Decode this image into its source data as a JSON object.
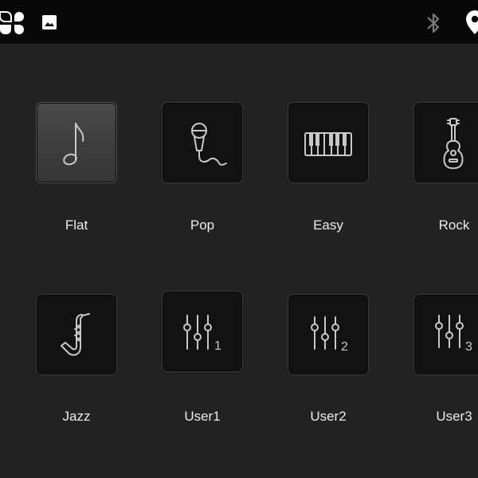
{
  "status_bar": {
    "icons": [
      "apps-grid-icon",
      "image-icon",
      "bluetooth-icon",
      "location-pin-icon"
    ]
  },
  "equalizer": {
    "presets": [
      {
        "label": "Flat",
        "icon": "music-note-icon",
        "selected": true
      },
      {
        "label": "Pop",
        "icon": "microphone-icon",
        "selected": false
      },
      {
        "label": "Easy",
        "icon": "piano-keys-icon",
        "selected": false
      },
      {
        "label": "Rock",
        "icon": "guitar-icon",
        "selected": false
      },
      {
        "label": "Jazz",
        "icon": "saxophone-icon",
        "selected": false
      },
      {
        "label": "User1",
        "icon": "sliders-1-icon",
        "selected": false
      },
      {
        "label": "User2",
        "icon": "sliders-2-icon",
        "selected": false
      },
      {
        "label": "User3",
        "icon": "sliders-3-icon",
        "selected": false
      }
    ],
    "slider_numbers": [
      "1",
      "2",
      "3"
    ]
  },
  "colors": {
    "background": "#222222",
    "status_bar": "#080808",
    "tile": "#121212",
    "tile_selected": "#444444",
    "icon_stroke": "#c8c8c8",
    "label_text": "#ececec"
  }
}
